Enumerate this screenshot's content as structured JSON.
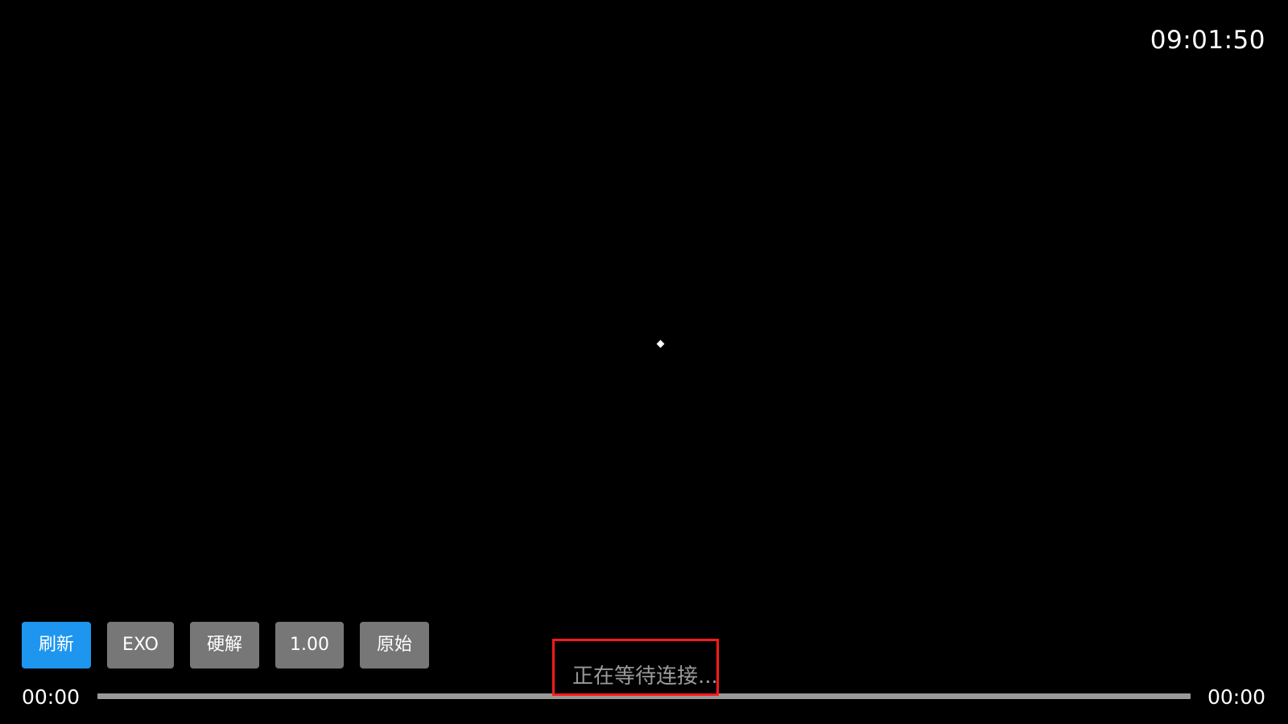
{
  "player": {
    "clock": "09:01:50",
    "status_text": "正在等待连接...",
    "current_time": "00:00",
    "total_time": "00:00",
    "progress": 0
  },
  "controls": [
    {
      "label": "刷新",
      "active": true
    },
    {
      "label": "EXO",
      "active": false
    },
    {
      "label": "硬解",
      "active": false
    },
    {
      "label": "1.00",
      "active": false
    },
    {
      "label": "原始",
      "active": false
    }
  ],
  "colors": {
    "background": "#000000",
    "active_button": "#1e96f0",
    "button": "#777777",
    "highlight_border": "#ff1a1a",
    "progress_track": "#999999"
  },
  "icons": {
    "loading": "loading-spinner-icon"
  }
}
